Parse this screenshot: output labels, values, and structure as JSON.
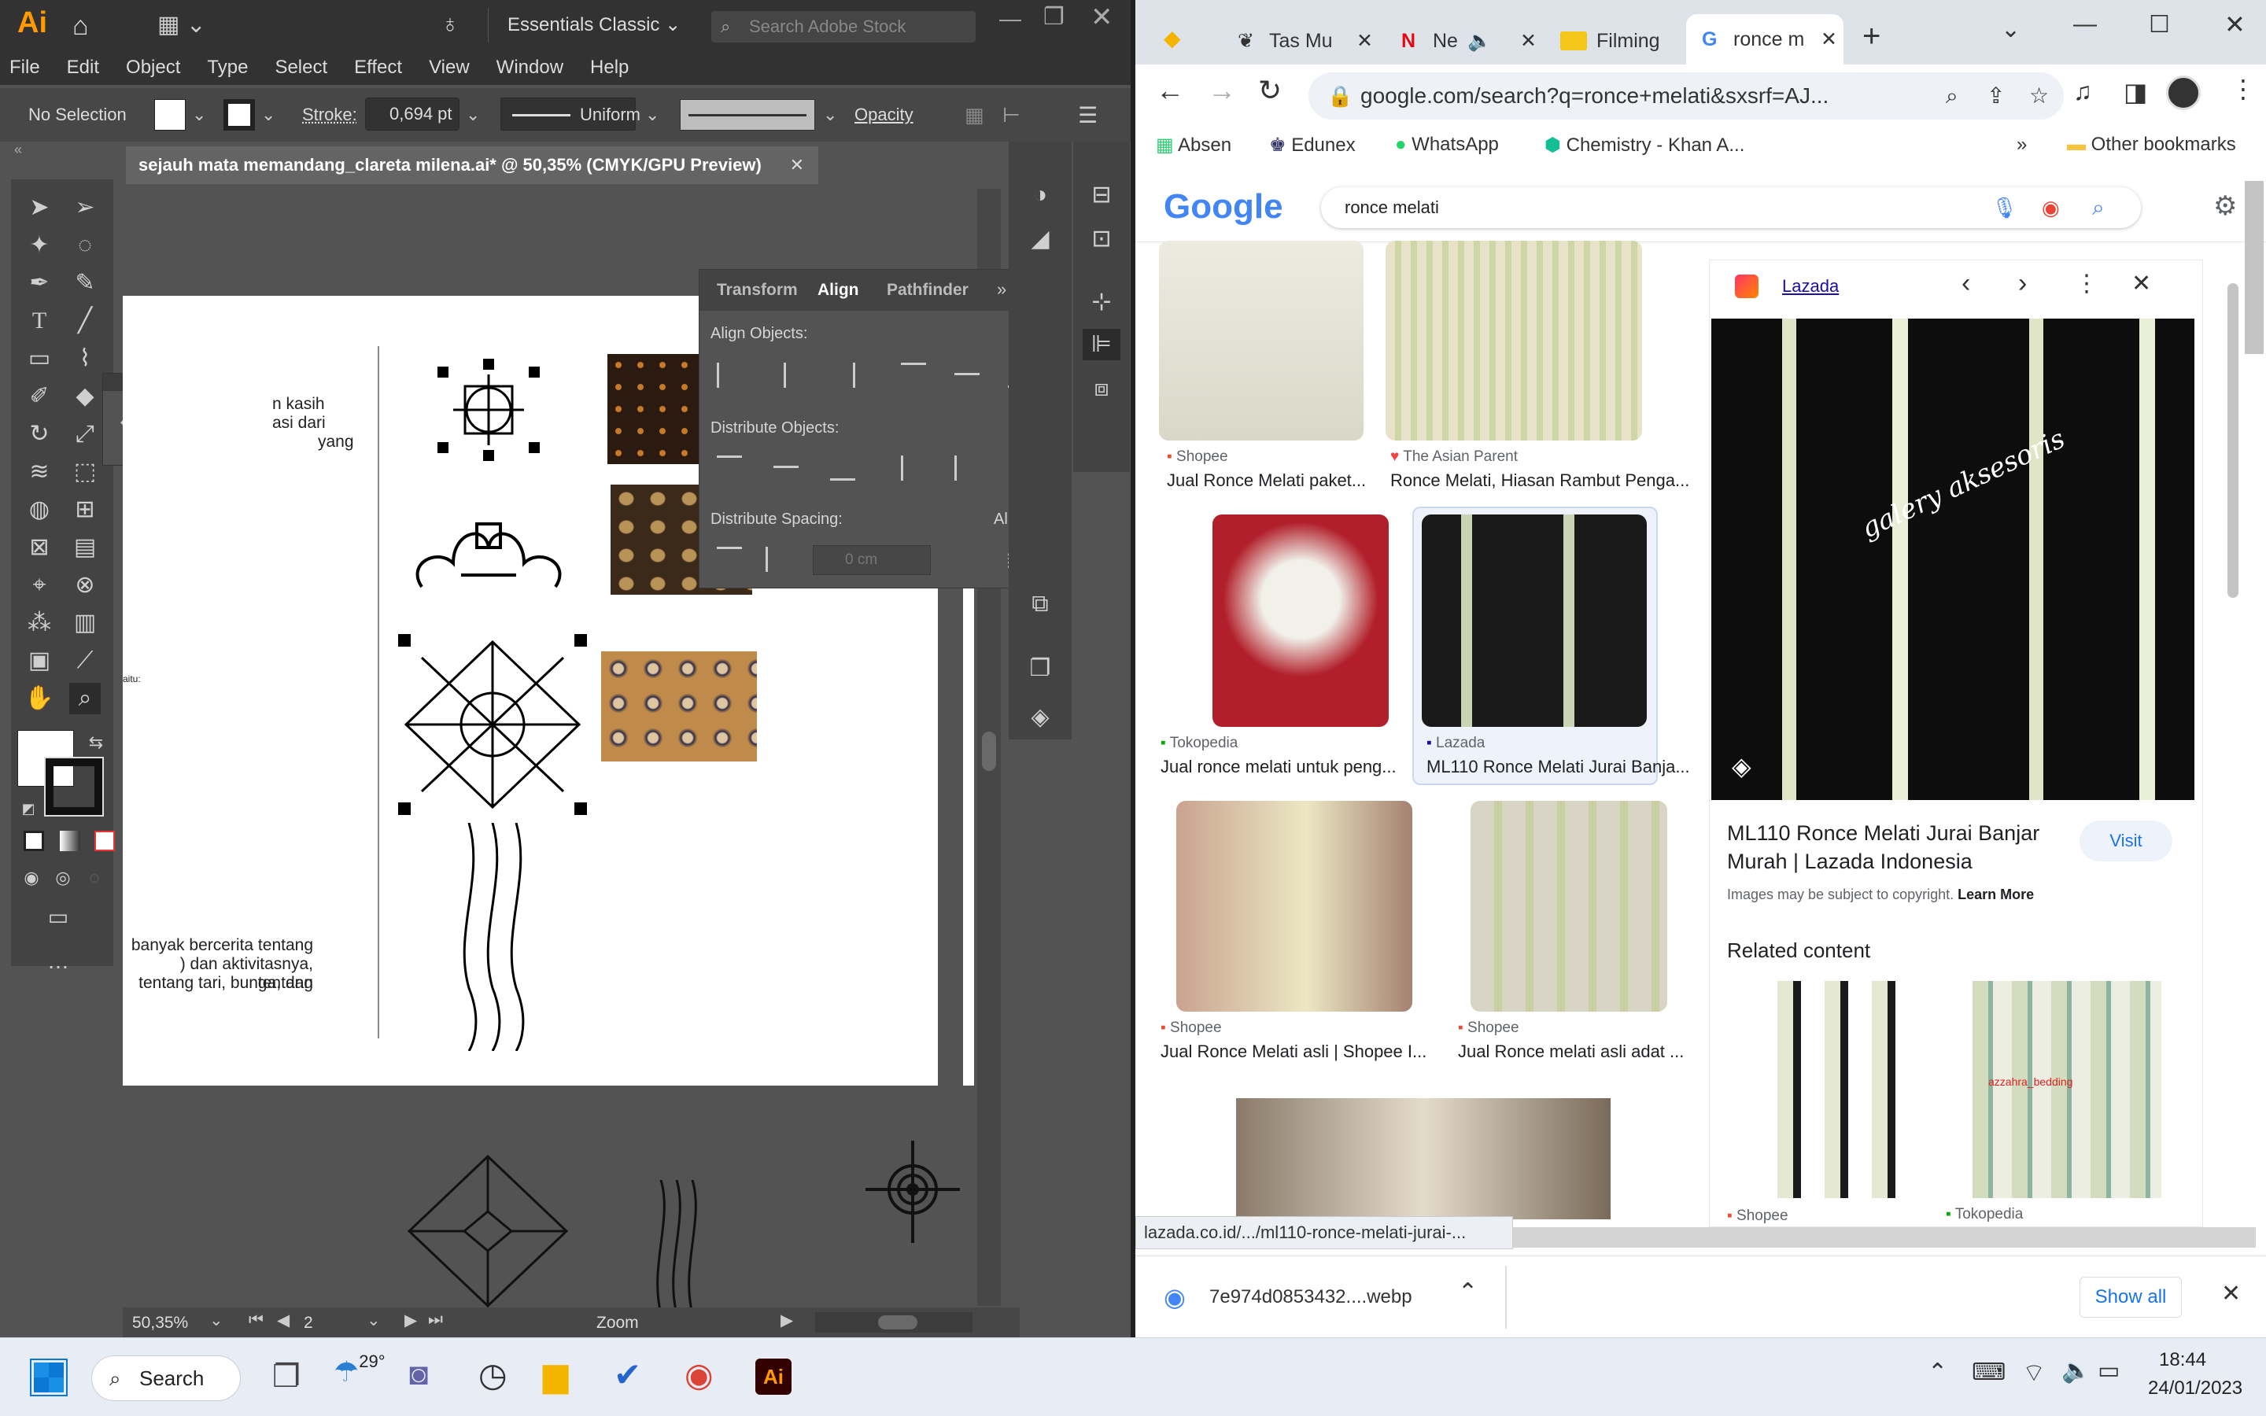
{
  "illustrator": {
    "logo": "Ai",
    "workspace": "Essentials Classic",
    "stock_search_placeholder": "Search Adobe Stock",
    "menu": [
      "File",
      "Edit",
      "Object",
      "Type",
      "Select",
      "Effect",
      "View",
      "Window",
      "Help"
    ],
    "control": {
      "selection": "No Selection",
      "stroke_label": "Stroke:",
      "stroke_value": "0,694 pt",
      "profile": "Uniform",
      "opacity_label": "Opacity"
    },
    "doc_tab": "sejauh mata memandang_clareta milena.ai* @ 50,35% (CMYK/GPU Preview)",
    "artboard_text": {
      "t1": "n  kasih",
      "t2": "asi dari",
      "t3": "yang",
      "t4": "aitu:",
      "t5": "banyak bercerita tentang",
      "t6": ") dan aktivitasnya, tentang",
      "t7": "tentang tari, bunga, dan"
    },
    "align_panel": {
      "tabs": [
        "Transform",
        "Align",
        "Pathfinder"
      ],
      "align_objects": "Align Objects:",
      "distribute_objects": "Distribute Objects:",
      "distribute_spacing": "Distribute Spacing:",
      "align_to": "Align To:",
      "spacing_value": "0 cm"
    },
    "status": {
      "zoom": "50,35%",
      "artboard_num": "2",
      "mode": "Zoom"
    }
  },
  "chrome": {
    "tabs": [
      {
        "label": "Tas Mu"
      },
      {
        "label": "Ne"
      },
      {
        "label": "Filming"
      },
      {
        "label": "ronce m"
      }
    ],
    "address": "google.com/search?q=ronce+melati&sxsrf=AJ...",
    "bookmarks": [
      "Absen",
      "Edunex",
      "WhatsApp",
      "Chemistry - Khan A..."
    ],
    "other_bookmarks": "Other bookmarks",
    "google": {
      "logo": "Google",
      "query": "ronce melati"
    },
    "results": [
      {
        "source": "Shopee",
        "caption": "Jual Ronce Melati paket..."
      },
      {
        "source": "The Asian Parent",
        "caption": "Ronce Melati, Hiasan Rambut Penga..."
      },
      {
        "source": "Tokopedia",
        "caption": "Jual ronce melati untuk peng..."
      },
      {
        "source": "Lazada",
        "caption": "ML110 Ronce Melati Jurai Banja..."
      },
      {
        "source": "Shopee",
        "caption": "Jual Ronce Melati asli | Shopee I..."
      },
      {
        "source": "Shopee",
        "caption": "Jual Ronce melati asli adat ..."
      }
    ],
    "viewer": {
      "source": "Lazada",
      "title": "ML110 Ronce Melati Jurai Banjar Murah | Lazada Indonesia",
      "visit": "Visit",
      "copyright": "Images may be subject to copyright.",
      "learn_more": "Learn More",
      "related": "Related content",
      "watermark": "galery aksesoris",
      "rel_sources": [
        "Shopee",
        "Tokopedia"
      ],
      "rel_watermark": "azzahra_bedding"
    },
    "status_url": "lazada.co.id/.../ml110-ronce-melati-jurai-...",
    "download": {
      "file": "7e974d0853432....webp",
      "show_all": "Show all"
    }
  },
  "taskbar": {
    "search": "Search",
    "weather": "29°",
    "time": "18:44",
    "date": "24/01/2023",
    "ai_label": "Ai"
  },
  "colors": {
    "ai_dark": "#323232",
    "ai_panel": "#535353",
    "chrome_tab": "#dee3ea",
    "google_blue": "#4285f4",
    "taskbar": "#e8edf5"
  }
}
